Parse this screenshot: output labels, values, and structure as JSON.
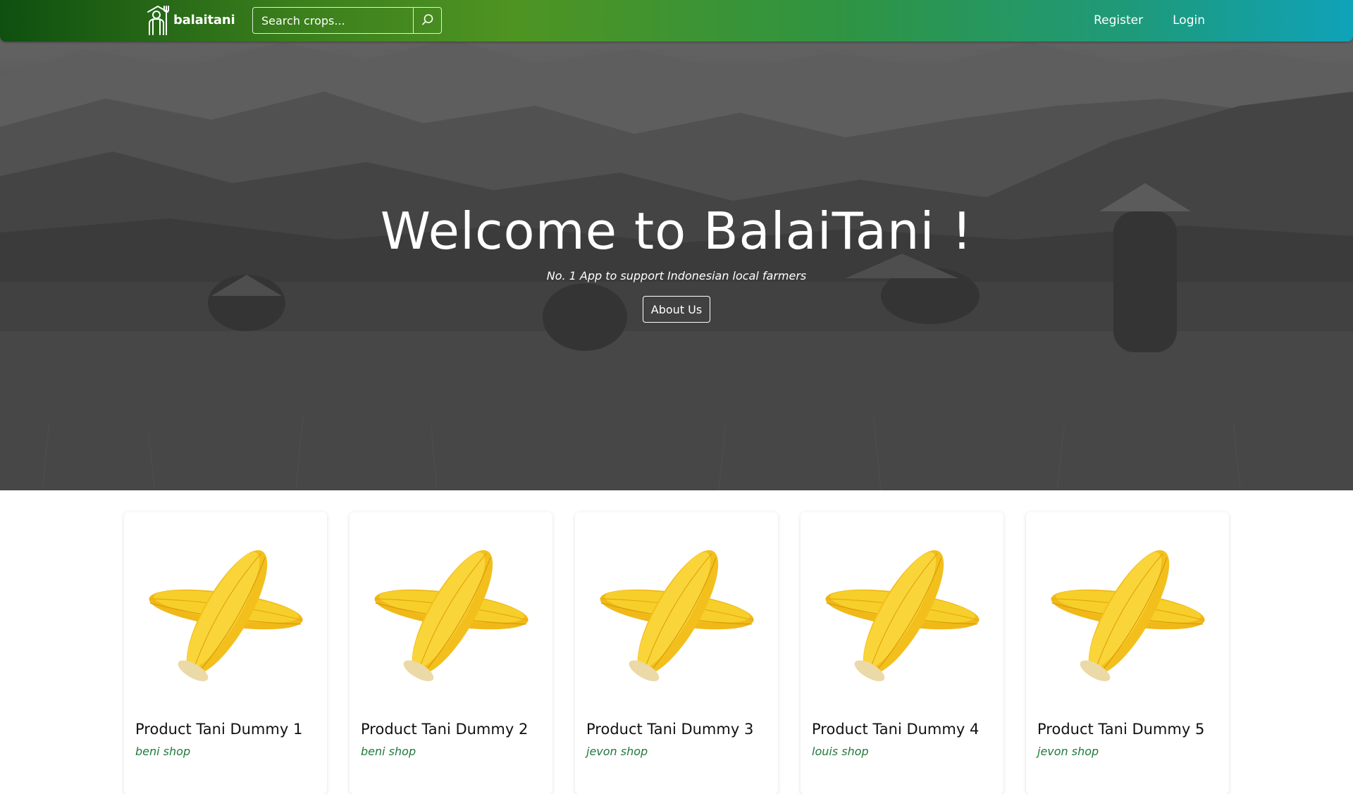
{
  "brand": {
    "name": "balaitani",
    "logo_icon": "farmer-icon"
  },
  "search": {
    "placeholder": "Search crops...",
    "button_icon": "search-icon"
  },
  "nav": {
    "register_label": "Register",
    "login_label": "Login"
  },
  "hero": {
    "title": "Welcome to BalaiTani !",
    "subtitle": "No. 1 App to support Indonesian local farmers",
    "about_label": "About Us"
  },
  "products": [
    {
      "name": "Product Tani Dummy 1",
      "shop": "beni shop",
      "image": "corn-image"
    },
    {
      "name": "Product Tani Dummy 2",
      "shop": "beni shop",
      "image": "corn-image"
    },
    {
      "name": "Product Tani Dummy 3",
      "shop": "jevon shop",
      "image": "corn-image"
    },
    {
      "name": "Product Tani Dummy 4",
      "shop": "louis shop",
      "image": "corn-image"
    },
    {
      "name": "Product Tani Dummy 5",
      "shop": "jevon shop",
      "image": "corn-image"
    }
  ],
  "colors": {
    "navbar_gradient_start": "#0f4f10",
    "navbar_gradient_end": "#0fa2b9",
    "shop_text": "#1f7a3a",
    "corn": "#f5c518"
  }
}
